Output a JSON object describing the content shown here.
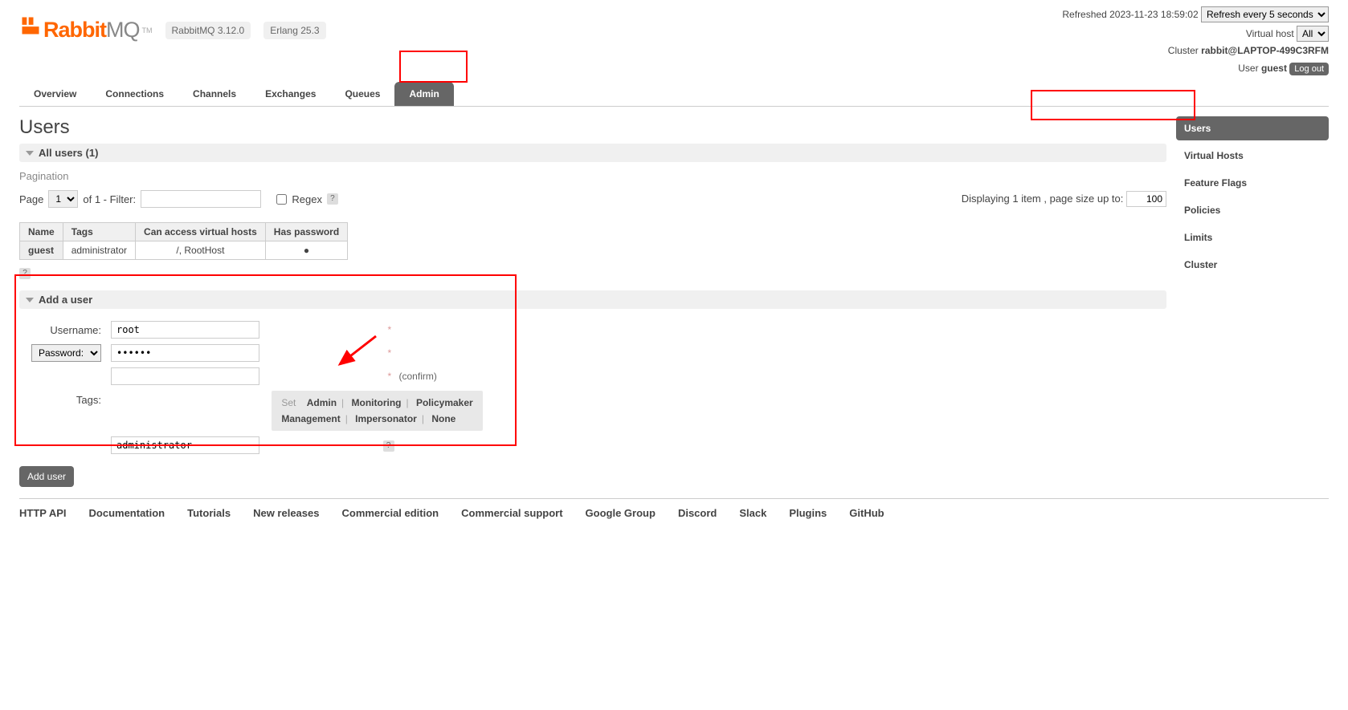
{
  "header": {
    "refreshed_label": "Refreshed",
    "refreshed_time": "2023-11-23 18:59:02",
    "refresh_select": "Refresh every 5 seconds",
    "vhost_label": "Virtual host",
    "vhost_value": "All",
    "cluster_label": "Cluster",
    "cluster_value": "rabbit@LAPTOP-499C3RFM",
    "user_label": "User",
    "user_value": "guest",
    "logout": "Log out",
    "version1": "RabbitMQ 3.12.0",
    "version2": "Erlang 25.3",
    "logo_r": "Rabbit",
    "logo_mq": "MQ",
    "logo_tm": "TM"
  },
  "nav": {
    "overview": "Overview",
    "connections": "Connections",
    "channels": "Channels",
    "exchanges": "Exchanges",
    "queues": "Queues",
    "admin": "Admin"
  },
  "sidebar": {
    "users": "Users",
    "vhosts": "Virtual Hosts",
    "feature_flags": "Feature Flags",
    "policies": "Policies",
    "limits": "Limits",
    "cluster": "Cluster"
  },
  "page": {
    "title": "Users",
    "all_users": "All users (1)",
    "pagination": "Pagination",
    "page_label": "Page",
    "page_value": "1",
    "of_label": "of 1  - Filter:",
    "regex_label": "Regex",
    "displaying": "Displaying 1 item , page size up to:",
    "page_size": "100"
  },
  "table": {
    "h_name": "Name",
    "h_tags": "Tags",
    "h_access": "Can access virtual hosts",
    "h_password": "Has password",
    "r0_name": "guest",
    "r0_tags": "administrator",
    "r0_access": "/, RootHost",
    "r0_password": "●"
  },
  "form": {
    "section": "Add a user",
    "username_label": "Username:",
    "username_value": "root",
    "password_label": "Password:",
    "password_value": "●●●●●●",
    "confirm_label": "(confirm)",
    "tags_label": "Tags:",
    "tags_value": "administrator",
    "set_label": "Set",
    "tag_admin": "Admin",
    "tag_monitoring": "Monitoring",
    "tag_policymaker": "Policymaker",
    "tag_management": "Management",
    "tag_impersonator": "Impersonator",
    "tag_none": "None",
    "submit": "Add user"
  },
  "footer": {
    "http_api": "HTTP API",
    "documentation": "Documentation",
    "tutorials": "Tutorials",
    "new_releases": "New releases",
    "commercial_edition": "Commercial edition",
    "commercial_support": "Commercial support",
    "google_group": "Google Group",
    "discord": "Discord",
    "slack": "Slack",
    "plugins": "Plugins",
    "github": "GitHub"
  }
}
